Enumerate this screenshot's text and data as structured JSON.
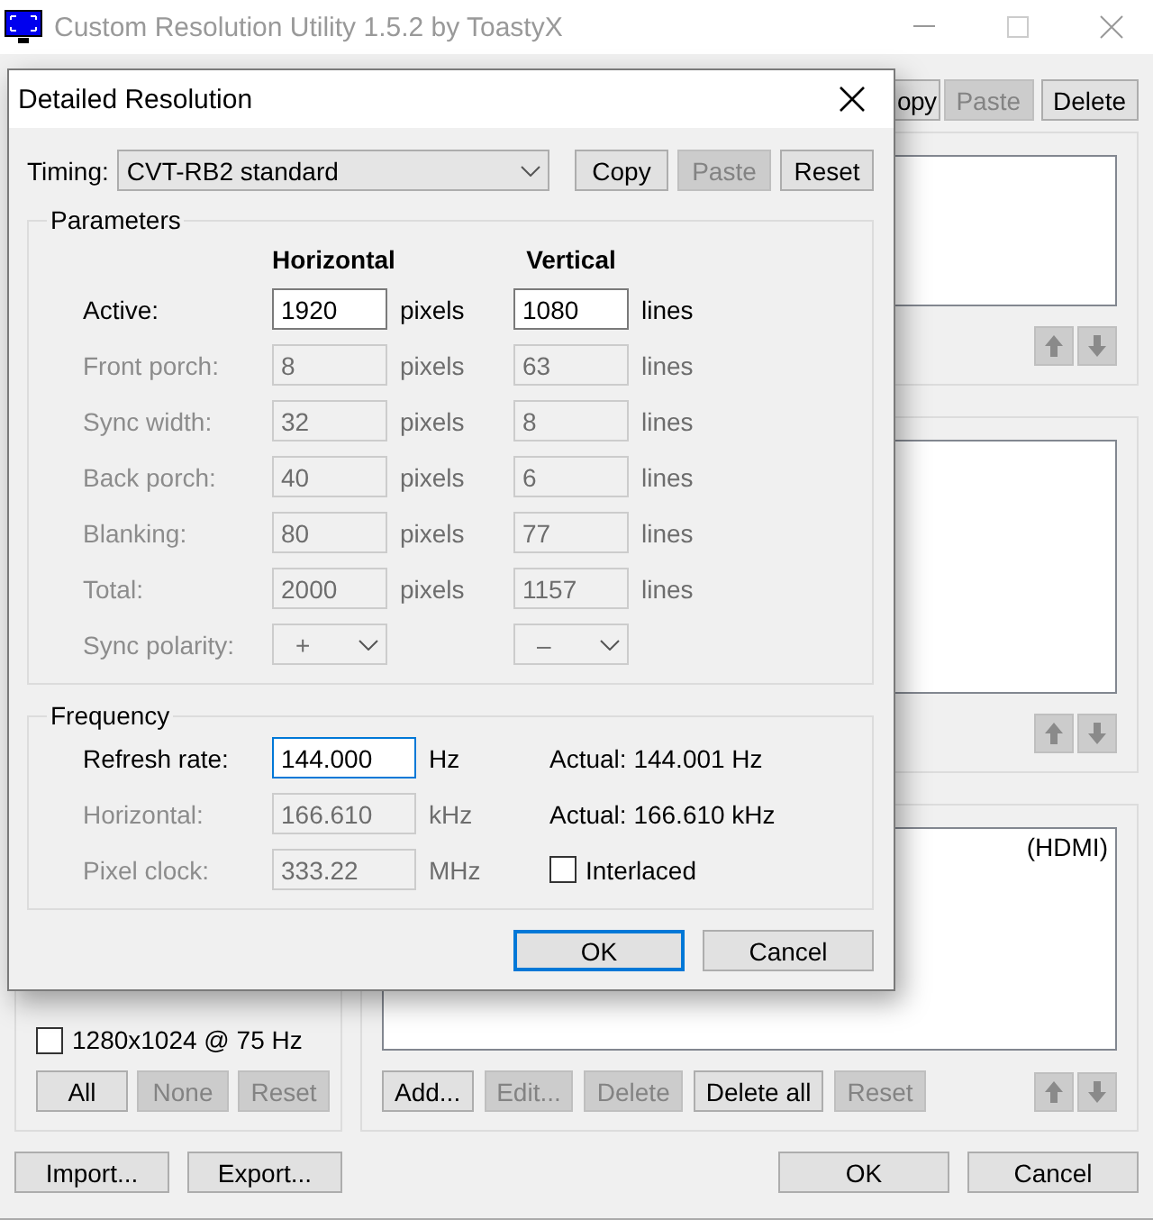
{
  "main_window": {
    "title": "Custom Resolution Utility 1.5.2 by ToastyX",
    "top_buttons": [
      {
        "label": "opy",
        "disabled": false
      },
      {
        "label": "Paste",
        "disabled": true
      },
      {
        "label": "Delete",
        "disabled": false
      }
    ],
    "device_panel": {
      "items": [
        "(HDMI)"
      ],
      "buttons": [
        {
          "label": "Add...",
          "disabled": false
        },
        {
          "label": "Edit...",
          "disabled": true
        },
        {
          "label": "Delete",
          "disabled": true
        },
        {
          "label": "Delete all",
          "disabled": false
        },
        {
          "label": "Reset",
          "disabled": true
        }
      ]
    },
    "left_checkbox": {
      "label": "1280x1024 @ 75 Hz",
      "checked": false
    },
    "left_buttons": [
      {
        "label": "All",
        "disabled": false
      },
      {
        "label": "None",
        "disabled": true
      },
      {
        "label": "Reset",
        "disabled": true
      }
    ],
    "footer_left": [
      {
        "label": "Import..."
      },
      {
        "label": "Export..."
      }
    ],
    "footer_right": [
      {
        "label": "OK"
      },
      {
        "label": "Cancel"
      }
    ]
  },
  "dialog": {
    "title": "Detailed Resolution",
    "timing": {
      "label": "Timing:",
      "value": "CVT-RB2 standard"
    },
    "timing_buttons": [
      {
        "label": "Copy",
        "disabled": false
      },
      {
        "label": "Paste",
        "disabled": true
      },
      {
        "label": "Reset",
        "disabled": false
      }
    ],
    "parameters": {
      "title": "Parameters",
      "headers": [
        "Horizontal",
        "Vertical"
      ],
      "rows": [
        {
          "kind": "input",
          "label": "Active:",
          "disabled": false,
          "h_value": "1920",
          "h_unit": "pixels",
          "v_value": "1080",
          "v_unit": "lines"
        },
        {
          "kind": "input",
          "label": "Front porch:",
          "disabled": true,
          "h_value": "8",
          "h_unit": "pixels",
          "v_value": "63",
          "v_unit": "lines"
        },
        {
          "kind": "input",
          "label": "Sync width:",
          "disabled": true,
          "h_value": "32",
          "h_unit": "pixels",
          "v_value": "8",
          "v_unit": "lines"
        },
        {
          "kind": "input",
          "label": "Back porch:",
          "disabled": true,
          "h_value": "40",
          "h_unit": "pixels",
          "v_value": "6",
          "v_unit": "lines"
        },
        {
          "kind": "input",
          "label": "Blanking:",
          "disabled": true,
          "h_value": "80",
          "h_unit": "pixels",
          "v_value": "77",
          "v_unit": "lines"
        },
        {
          "kind": "input",
          "label": "Total:",
          "disabled": true,
          "h_value": "2000",
          "h_unit": "pixels",
          "v_value": "1157",
          "v_unit": "lines"
        },
        {
          "kind": "select",
          "label": "Sync polarity:",
          "disabled": true,
          "h_value": "+",
          "v_value": "–"
        }
      ]
    },
    "frequency": {
      "title": "Frequency",
      "rows": [
        {
          "kind": "actual",
          "label": "Refresh rate:",
          "disabled": false,
          "focused": true,
          "value": "144.000",
          "unit": "Hz",
          "extra": "Actual: 144.001 Hz"
        },
        {
          "kind": "actual",
          "label": "Horizontal:",
          "disabled": true,
          "focused": false,
          "value": "166.610",
          "unit": "kHz",
          "extra": "Actual: 166.610 kHz"
        },
        {
          "kind": "checkbox",
          "label": "Pixel clock:",
          "disabled": true,
          "focused": false,
          "value": "333.22",
          "unit": "MHz",
          "extra": "Interlaced",
          "checked": false
        }
      ]
    },
    "buttons": [
      {
        "label": "OK",
        "default": true
      },
      {
        "label": "Cancel",
        "default": false
      }
    ]
  }
}
